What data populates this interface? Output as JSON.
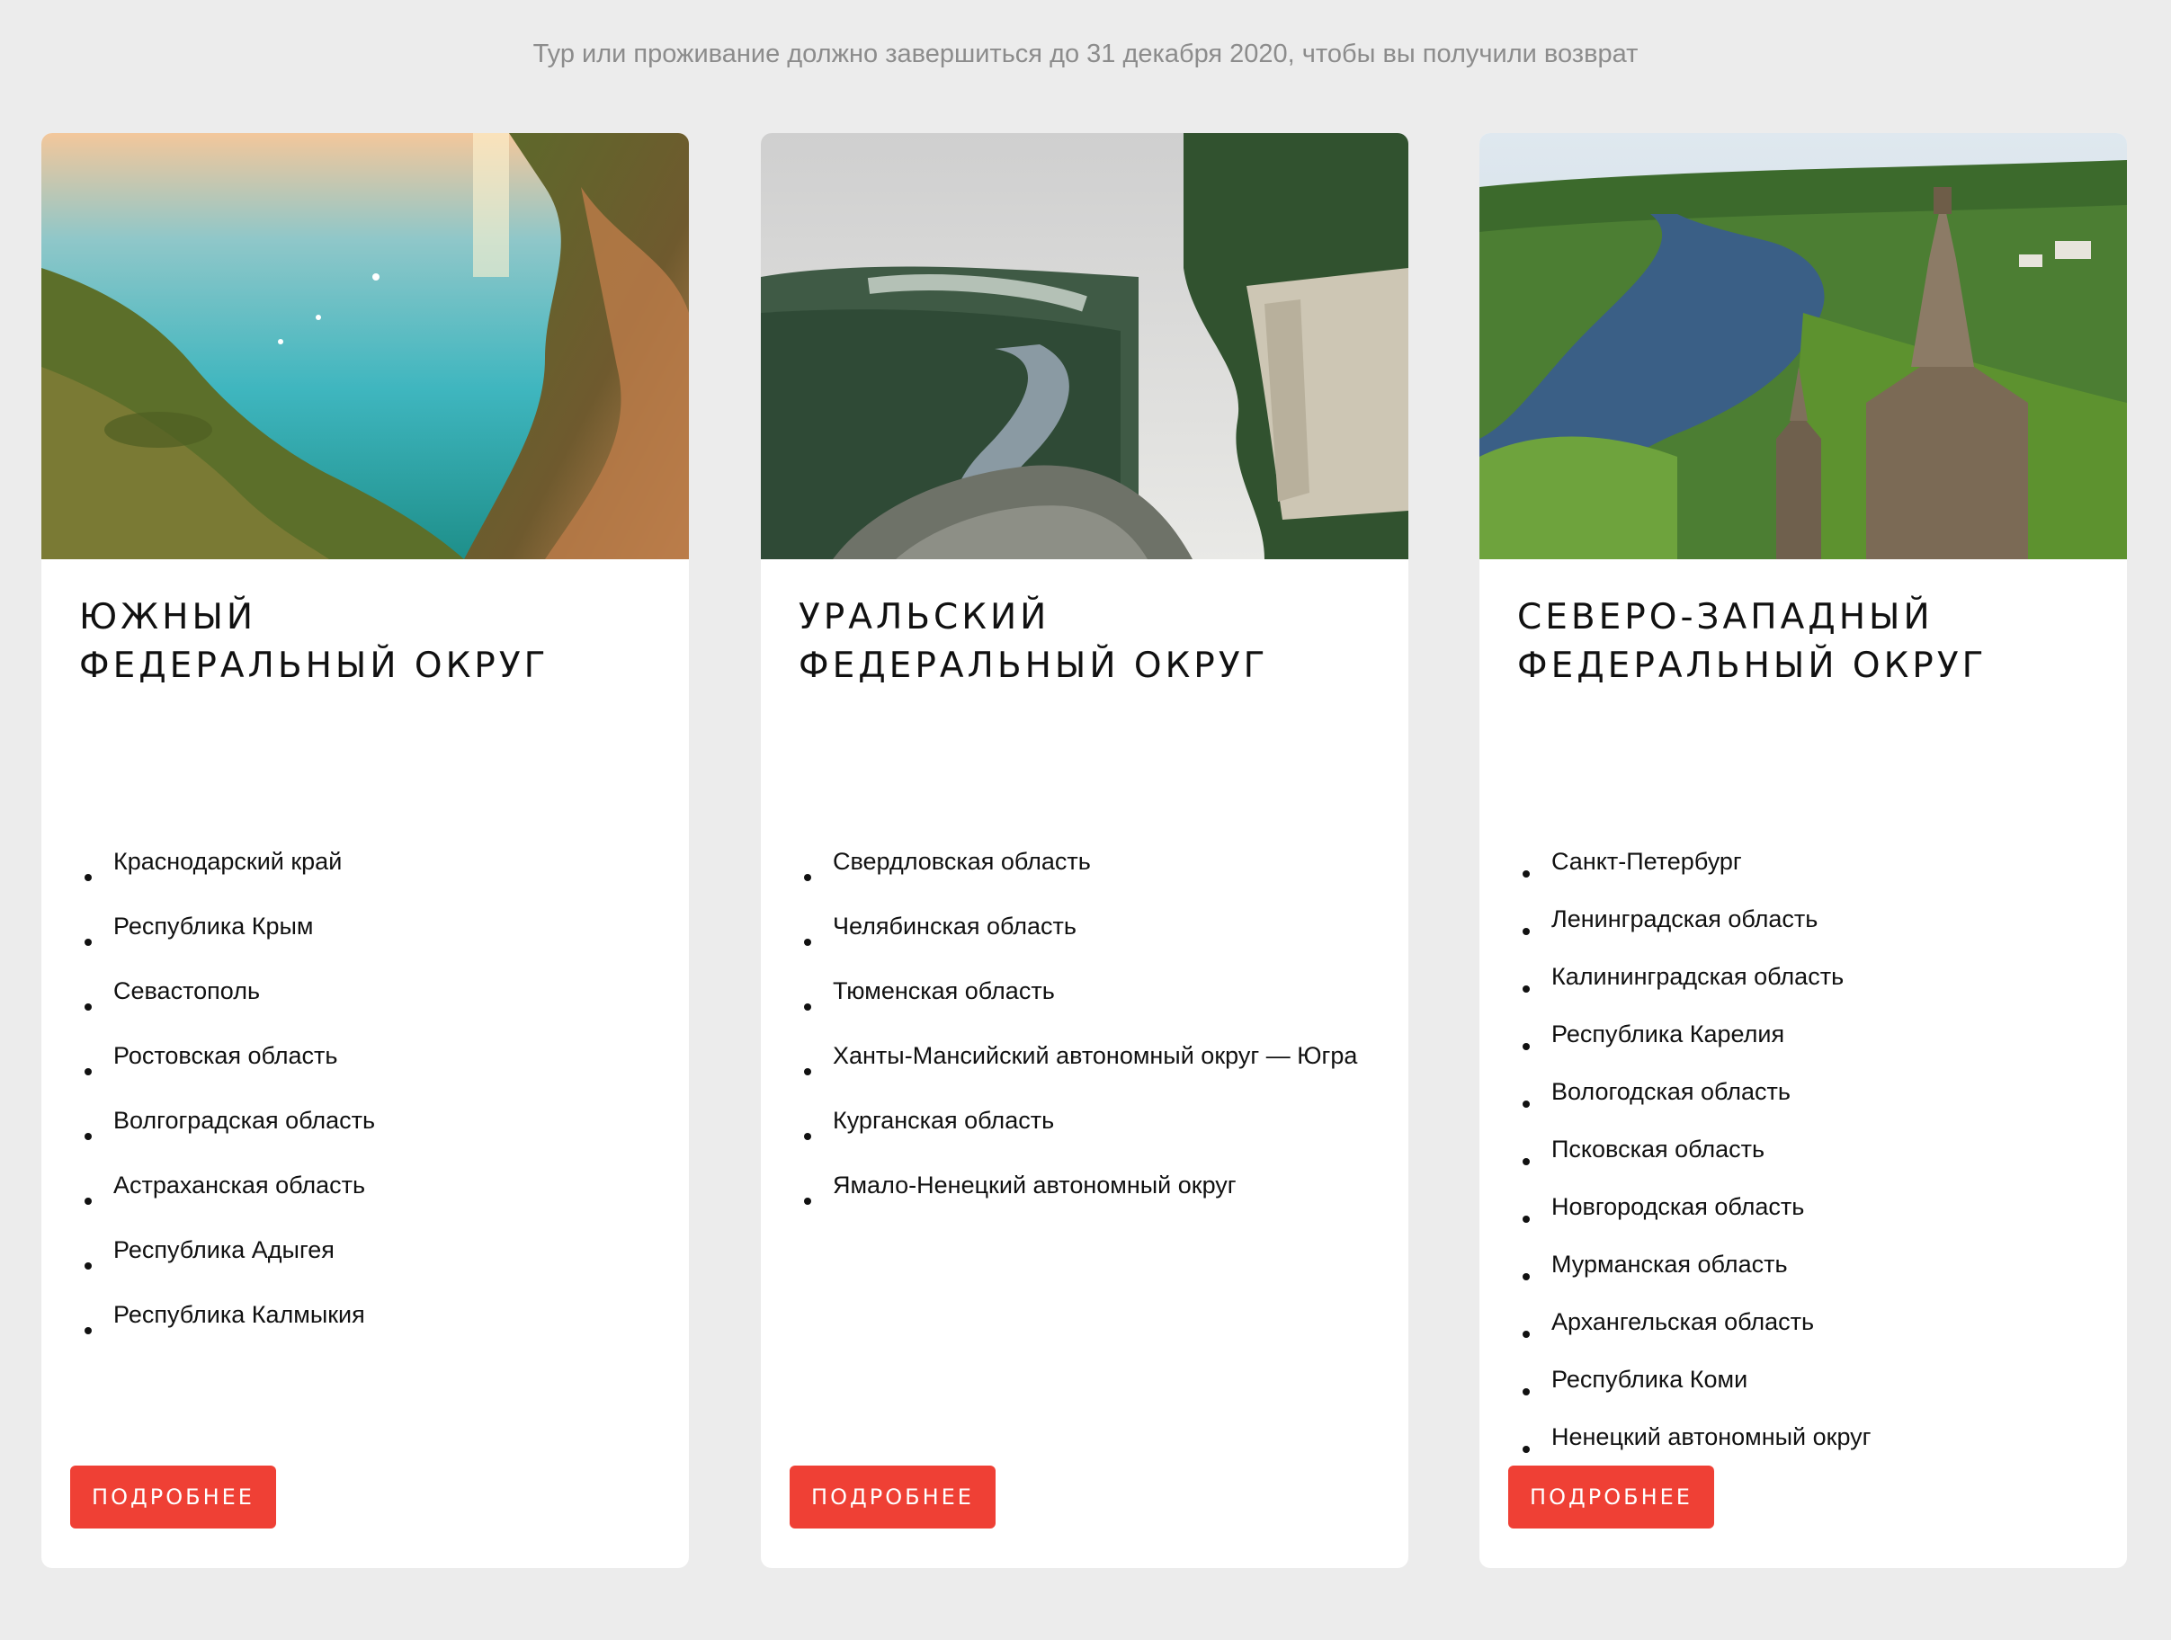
{
  "notice": "Тур или проживание должно завершиться до 31 декабря 2020, чтобы вы получили возврат",
  "cards": [
    {
      "title_line1": "Южный",
      "title_line2": "федеральный округ",
      "regions": [
        "Краснодарский край",
        "Республика Крым",
        "Севастополь",
        "Ростовская область",
        "Волгоградская область",
        "Астраханская область",
        "Республика Адыгея",
        "Республика Калмыкия"
      ],
      "button_label": "Подробнее"
    },
    {
      "title_line1": "Уральский",
      "title_line2": "федеральный округ",
      "regions": [
        "Свердловская область",
        "Челябинская область",
        "Тюменская область",
        "Ханты-Мансийский автономный округ — Югра",
        "Курганская область",
        "Ямало-Ненецкий автономный округ"
      ],
      "button_label": "Подробнее"
    },
    {
      "title_line1": "Северо-Западный",
      "title_line2": "федеральный округ",
      "regions": [
        "Санкт-Петербург",
        "Ленинградская область",
        "Калининградская область",
        "Республика Карелия",
        "Вологодская область",
        "Псковская область",
        "Новгородская область",
        "Мурманская область",
        "Архангельская область",
        "Республика Коми",
        "Ненецкий автономный округ"
      ],
      "button_label": "Подробнее"
    }
  ],
  "colors": {
    "accent": "#ef4035",
    "background": "#ececec",
    "card": "#ffffff",
    "notice_text": "#8c8c8c"
  }
}
